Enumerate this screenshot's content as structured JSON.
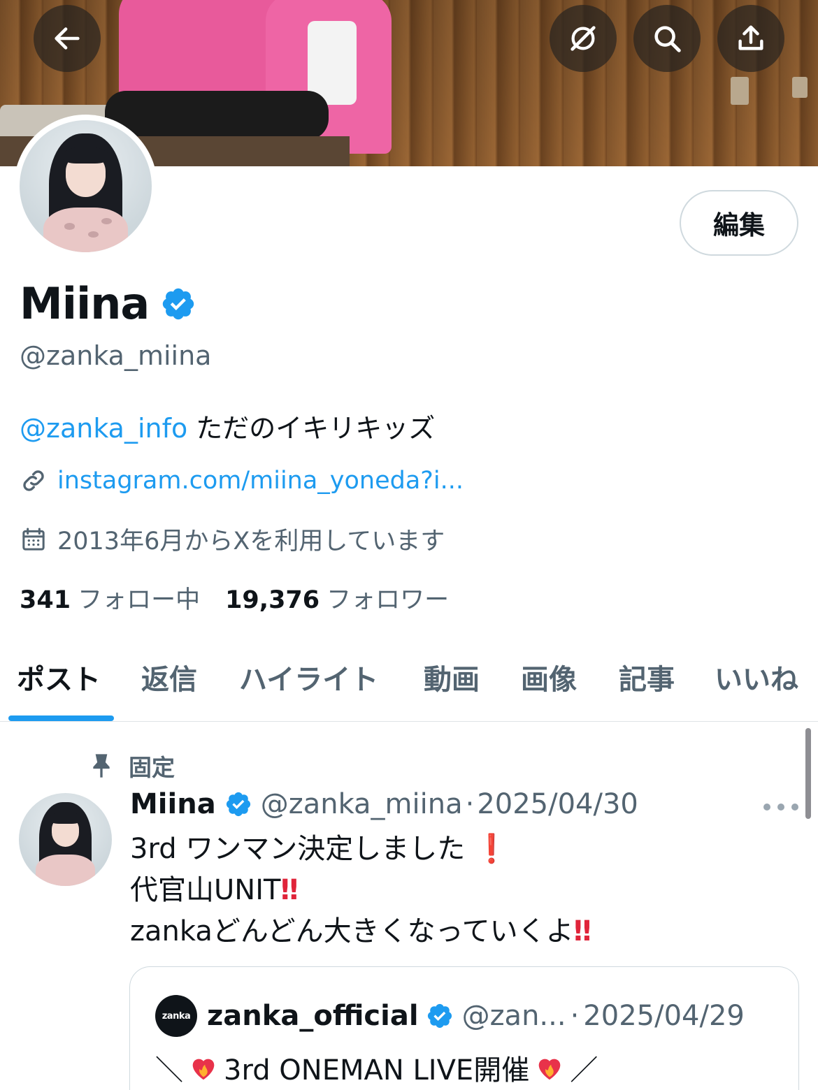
{
  "profile": {
    "display_name": "Miina",
    "handle": "@zanka_miina",
    "bio_mention": "@zanka_info",
    "bio_text": " ただのイキリキッズ",
    "link": "instagram.com/miina_yoneda?i...",
    "joined": "2013年6月からXを利用しています",
    "following_count": "341",
    "following_label": "フォロー中",
    "followers_count": "19,376",
    "followers_label": "フォロワー",
    "edit_label": "編集"
  },
  "top_bar": {
    "back_icon": "arrow-left-icon",
    "grok_icon": "grok-icon",
    "search_icon": "search-icon",
    "share_icon": "share-icon"
  },
  "tabs": [
    {
      "label": "ポスト",
      "active": true
    },
    {
      "label": "返信"
    },
    {
      "label": "ハイライト"
    },
    {
      "label": "動画"
    },
    {
      "label": "画像"
    },
    {
      "label": "記事"
    },
    {
      "label": "いいね"
    }
  ],
  "pinned_post": {
    "pinned_label": "固定",
    "author_name": "Miina",
    "author_handle": "@zanka_miina",
    "separator": "·",
    "date": "2025/04/30",
    "lines": [
      {
        "text": "3rd ワンマン決定しました",
        "mark": "❗"
      },
      {
        "text": "代官山UNIT",
        "mark": "‼"
      },
      {
        "text": "zankaどんどん大きくなっていくよ",
        "mark": "‼"
      }
    ],
    "quote": {
      "logo_text": "zanka",
      "author_name": "zanka_official",
      "author_handle": "@zan...",
      "separator": "·",
      "date": "2025/04/29",
      "text_prefix": "＼",
      "text_main": "3rd ONEMAN LIVE開催",
      "text_suffix": "／"
    }
  },
  "colors": {
    "accent": "#1d9bf0",
    "text_primary": "#0f1419",
    "text_secondary": "#536471",
    "border": "#cfd9de",
    "exclamation": "#e0243a"
  }
}
